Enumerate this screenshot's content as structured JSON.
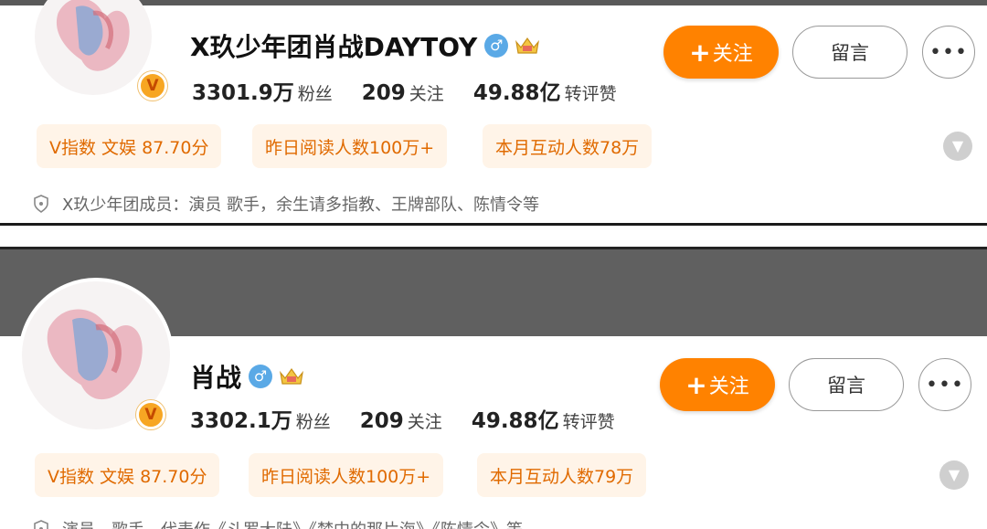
{
  "profile1": {
    "name": "X玖少年团肖战DAYTOY",
    "verified_badge": "V",
    "gender_icon": "male-icon",
    "gender_symbol": "♂",
    "stats": [
      {
        "num": "3301.9万",
        "label": "粉丝"
      },
      {
        "num": "209",
        "label": "关注"
      },
      {
        "num": "49.88亿",
        "label": "转评赞"
      }
    ],
    "follow_plus": "+",
    "follow_label": "关注",
    "message_label": "留言",
    "more_label": "•••",
    "tags": [
      "V指数 文娱 87.70分",
      "昨日阅读人数100万+",
      "本月互动人数78万"
    ],
    "description": "X玖少年团成员：演员 歌手，余生请多指教、王牌部队、陈情令等"
  },
  "profile2": {
    "name": "肖战",
    "verified_badge": "V",
    "gender_icon": "male-icon",
    "gender_symbol": "♂",
    "stats": [
      {
        "num": "3302.1万",
        "label": "粉丝"
      },
      {
        "num": "209",
        "label": "关注"
      },
      {
        "num": "49.88亿",
        "label": "转评赞"
      }
    ],
    "follow_plus": "+",
    "follow_label": "关注",
    "message_label": "留言",
    "more_label": "•••",
    "tags": [
      "V指数 文娱 87.70分",
      "昨日阅读人数100万+",
      "本月互动人数79万"
    ],
    "description": "演员，歌手，代表作《斗罗大陆》《梦中的那片海》《陈情令》等"
  },
  "colors": {
    "accent_orange": "#ff8200",
    "tag_bg": "#fff4e8",
    "tag_text": "#e06a00",
    "gender_blue": "#5aa9e6",
    "band_gray": "#606060"
  }
}
